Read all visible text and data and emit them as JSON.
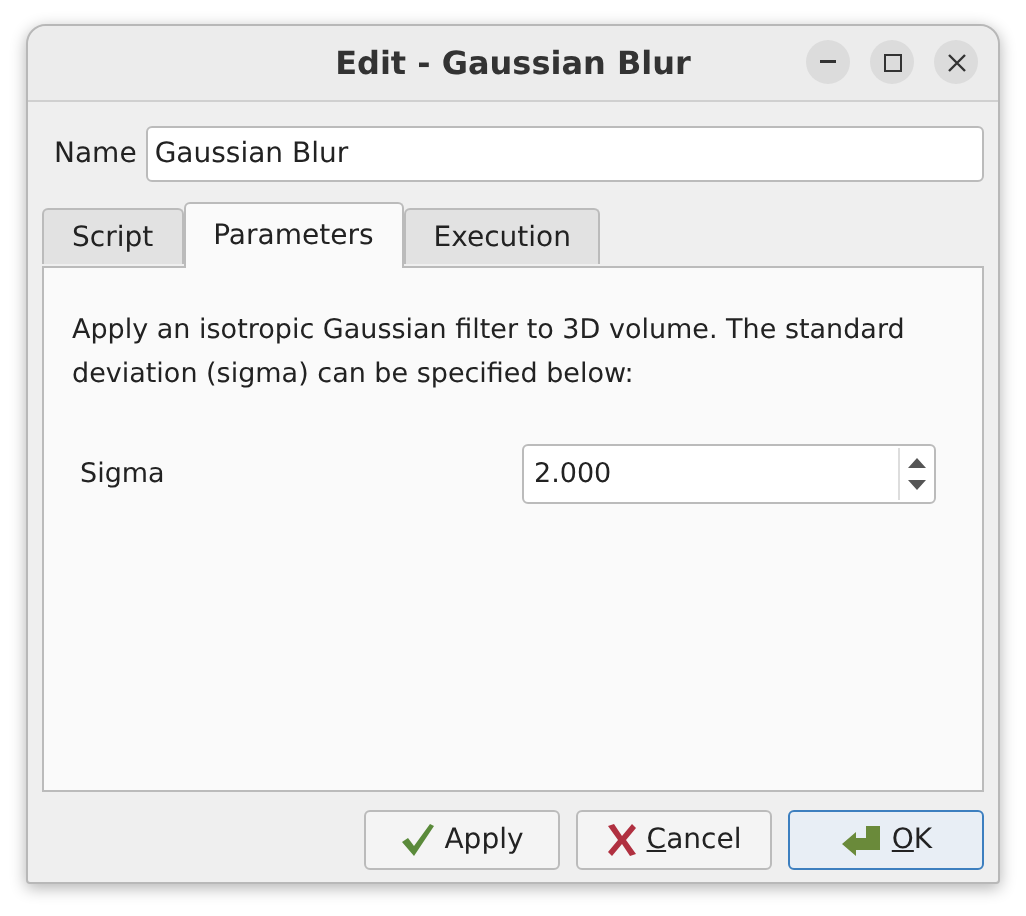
{
  "window": {
    "title": "Edit - Gaussian Blur"
  },
  "name_field": {
    "label": "Name",
    "value": "Gaussian Blur"
  },
  "tabs": [
    {
      "label": "Script",
      "selected": false
    },
    {
      "label": "Parameters",
      "selected": true
    },
    {
      "label": "Execution",
      "selected": false
    }
  ],
  "description": "Apply an isotropic Gaussian filter to 3D volume. The standard deviation (sigma) can be specified below:",
  "parameters": [
    {
      "label": "Sigma",
      "value": "2.000"
    }
  ],
  "buttons": [
    {
      "kind": "apply",
      "label": "Apply",
      "mnemonic_first": false,
      "default": false
    },
    {
      "kind": "cancel",
      "label": "Cancel",
      "mnemonic_first": true,
      "default": false
    },
    {
      "kind": "ok",
      "label": "OK",
      "mnemonic_first": true,
      "default": true
    }
  ]
}
